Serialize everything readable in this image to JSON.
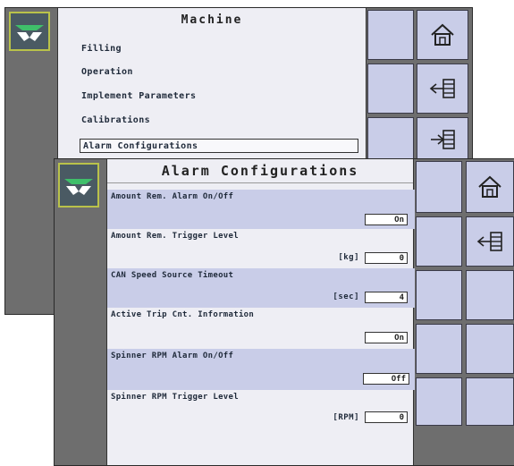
{
  "back_screen": {
    "title": "Machine",
    "menu": [
      {
        "label": "Filling"
      },
      {
        "label": "Operation"
      },
      {
        "label": "Implement Parameters"
      },
      {
        "label": "Calibrations"
      },
      {
        "label": "Alarm Configurations",
        "selected": true
      }
    ],
    "side_icons": [
      "home-icon",
      "back-list-icon",
      "forward-list-icon"
    ]
  },
  "front_screen": {
    "title": "Alarm Configurations",
    "settings": [
      {
        "label": "Amount Rem. Alarm On/Off",
        "unit": "",
        "value": "On",
        "highlighted": true
      },
      {
        "label": "Amount Rem. Trigger Level",
        "unit": "[kg]",
        "value": "0",
        "highlighted": false
      },
      {
        "label": "CAN Speed Source Timeout",
        "unit": "[sec]",
        "value": "4",
        "highlighted": true
      },
      {
        "label": "Active Trip Cnt. Information",
        "unit": "",
        "value": "On",
        "highlighted": false
      },
      {
        "label": "Spinner RPM Alarm On/Off",
        "unit": "",
        "value": "Off",
        "highlighted": true
      },
      {
        "label": "Spinner RPM Trigger Level",
        "unit": "[RPM]",
        "value": "0",
        "highlighted": false
      }
    ],
    "side_icons": [
      "home-icon",
      "back-list-icon"
    ]
  },
  "colors": {
    "screen_bg": "#6e6e6e",
    "panel_bg": "#eeeef4",
    "button_bg": "#c9cde8",
    "logo_border": "#b9c24a"
  }
}
